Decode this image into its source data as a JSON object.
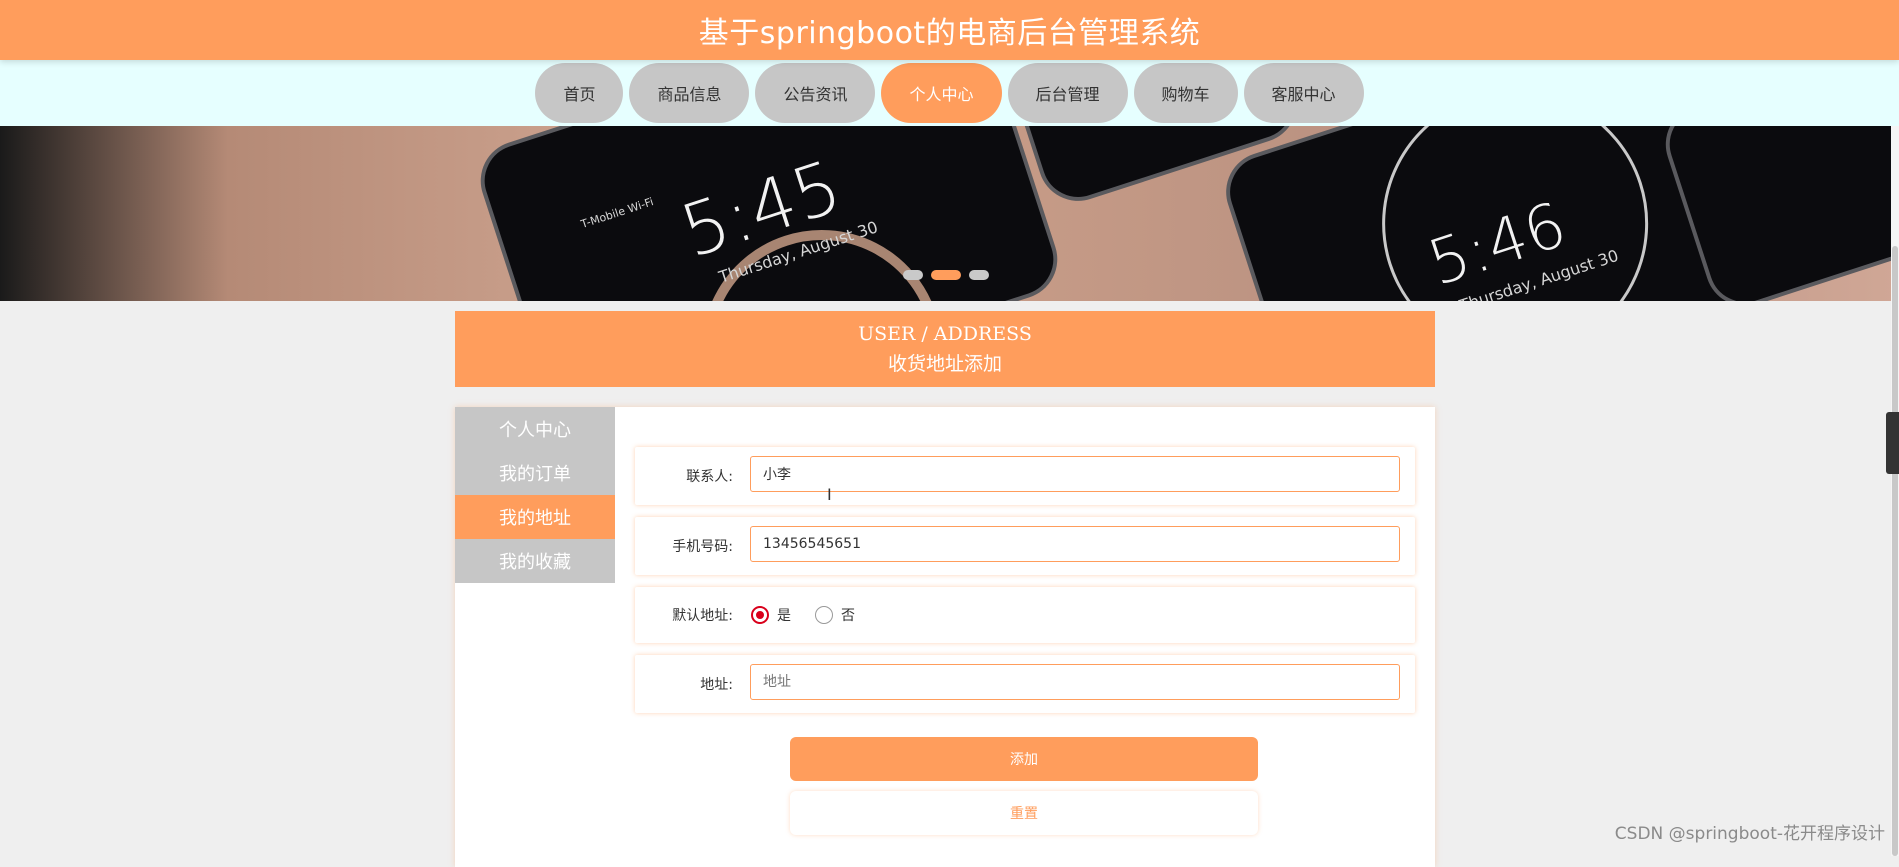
{
  "app": {
    "title": "基于springboot的电商后台管理系统"
  },
  "nav": {
    "items": [
      {
        "label": "首页"
      },
      {
        "label": "商品信息"
      },
      {
        "label": "公告资讯"
      },
      {
        "label": "个人中心"
      },
      {
        "label": "后台管理"
      },
      {
        "label": "购物车"
      },
      {
        "label": "客服中心"
      }
    ],
    "active": "个人中心"
  },
  "banner": {
    "clock_left": "5:45",
    "date_left": "Thursday, August 30",
    "carrier_left": "T-Mobile Wi-Fi",
    "clock_right": "5:46",
    "date_right": "Thursday, August 30",
    "active_slide": 2,
    "slide_count": 3
  },
  "section": {
    "en_title": "USER / ADDRESS",
    "cn_title": "收货地址添加"
  },
  "sidebar": {
    "items": [
      {
        "label": "个人中心"
      },
      {
        "label": "我的订单"
      },
      {
        "label": "我的地址"
      },
      {
        "label": "我的收藏"
      }
    ],
    "active": "我的地址"
  },
  "form": {
    "contact": {
      "label": "联系人:",
      "value": "小李"
    },
    "phone": {
      "label": "手机号码:",
      "value": "13456545651"
    },
    "default": {
      "label": "默认地址:",
      "yes": "是",
      "no": "否",
      "selected": "是"
    },
    "address": {
      "label": "地址:",
      "placeholder": "地址",
      "value": ""
    },
    "submit_label": "添加",
    "reset_label": "重置"
  },
  "watermark": "CSDN @springboot-花开程序设计",
  "colors": {
    "accent": "#ff9d5c",
    "inactive": "#c6c6c6",
    "nav_bg": "#e6ffff",
    "radio": "#d9001b"
  }
}
